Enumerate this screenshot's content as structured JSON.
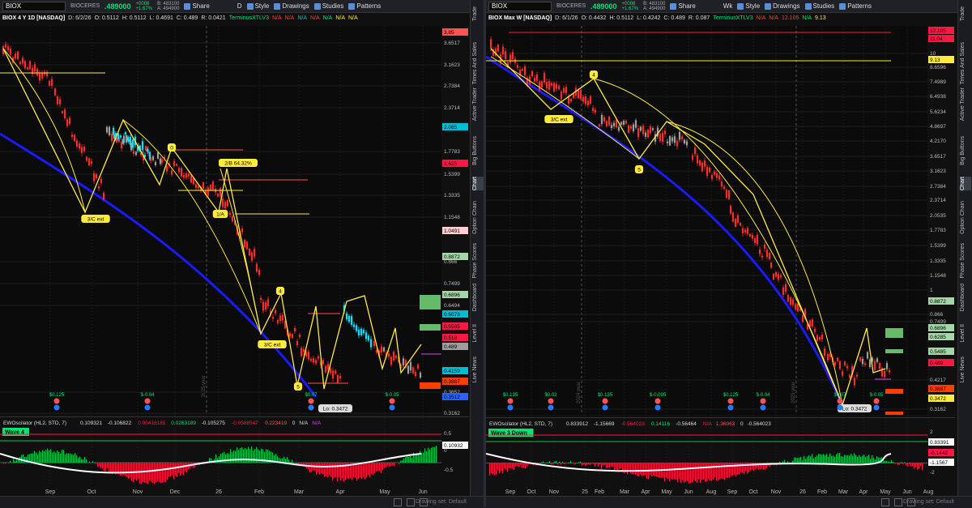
{
  "left": {
    "symbol": "BIOX",
    "company": "BIOCERES CR...",
    "price": ".489000",
    "change_line1": "+0008",
    "change_line2": "+1.67%",
    "bid": "B: 483100",
    "ask": "A: 494900",
    "timeframe_btn": "D",
    "toolbar": {
      "share": "Share",
      "style": "Style",
      "drawings": "Drawings",
      "studies": "Studies",
      "patterns": "Patterns"
    },
    "info": {
      "title": "BIOX 4 Y 1D [NASDAQ]",
      "date": "D: 6/2/26",
      "open": "O: 0.5112",
      "high": "H: 0.5112",
      "low": "L: 0.4691",
      "close": "C: 0.489",
      "range": "R: 0.0421",
      "study": "TerminusXTLV3",
      "na": "N/A"
    },
    "price_labels": [
      "3.85",
      "3.6517",
      "3.1623",
      "2.7384",
      "2.3714",
      "2.085",
      "1.7783",
      "1.625",
      "1.5399",
      "1.3335",
      "1.1548",
      "1.0491",
      "0.8872",
      "0.866",
      "0.7499",
      "0.6896",
      "0.6494",
      "0.6073",
      "0.5565",
      "0.518",
      "0.489",
      "0.4159",
      "0.3887",
      "0.3652",
      "0.3512",
      "0.3162"
    ],
    "months": [
      "Sep",
      "Oct",
      "Nov",
      "Dec",
      "26",
      "Feb",
      "Mar",
      "Apr",
      "May",
      "Jun"
    ],
    "year_label": "2025 year",
    "wave_labels": [
      "3/C ext",
      "0",
      "2/B 64.32%",
      "1/A",
      "4",
      "3/C ext",
      "5"
    ],
    "lo_label": "Lo: 0.3472",
    "earnings": [
      "$0.125",
      "$-0.04",
      "$0.07",
      "$-0.05"
    ],
    "osc_info": {
      "name": "EWOscilator (HL2, STD, 7)",
      "v1": "0.109321",
      "v2": "-0.106822",
      "v3": "0.00418181",
      "v4": "0.0263189",
      "v5": "-0.105275",
      "v6": "-0.0588547",
      "v7": "0.223419",
      "v8": "0",
      "v9": "N/A",
      "v10": "N/A"
    },
    "wave_badge": "Wave 4",
    "osc_scale": [
      "0.5",
      "0.10932",
      "0",
      "-0.5"
    ],
    "footer": "Drawing set: Default"
  },
  "right": {
    "symbol": "BIOX",
    "company": "BIOCERES CR...",
    "price": ".489000",
    "change_line1": "+0008",
    "change_line2": "+1.67%",
    "bid": "B: 483100",
    "ask": "A: 494900",
    "timeframe_btn": "Wk",
    "toolbar": {
      "share": "Share",
      "style": "Style",
      "drawings": "Drawings",
      "studies": "Studies",
      "patterns": "Patterns"
    },
    "info": {
      "title": "BIOX Max W [NASDAQ]",
      "date": "D: 6/1/26",
      "open": "O: 0.4432",
      "high": "H: 0.5112",
      "low": "L: 0.4242",
      "close": "C: 0.489",
      "range": "R: 0.087",
      "study": "TerminusXTLV3",
      "na": "N/A",
      "v1": "12.105",
      "v2": "9.13"
    },
    "price_labels": [
      "12.105",
      "11.04",
      "10",
      "9.13",
      "8.6596",
      "7.4989",
      "6.4938",
      "5.6234",
      "4.8697",
      "4.2170",
      "3.6517",
      "3.1623",
      "2.7384",
      "2.3714",
      "2.0535",
      "1.7783",
      "1.5399",
      "1.3335",
      "1.1548",
      "1",
      "0.8872",
      "0.866",
      "0.7499",
      "0.6896",
      "0.6285",
      "0.5485",
      "0.489",
      "0.4217",
      "0.3887",
      "0.3472",
      "0.3162"
    ],
    "months": [
      "Sep",
      "Oct",
      "Nov",
      "25",
      "Feb",
      "Mar",
      "Apr",
      "May",
      "Jun",
      "Aug",
      "Sep",
      "Oct",
      "Nov",
      "26",
      "Feb",
      "Mar",
      "Apr",
      "May",
      "Jun",
      "Aug"
    ],
    "year_labels": [
      "2024 year",
      "2025 year"
    ],
    "wave_labels": [
      "4",
      "3/C ext",
      "5"
    ],
    "lo_label": "Lo: 0.3472",
    "earnings": [
      "$0.135",
      "$0.02",
      "$0.135",
      "$-0.095",
      "$0.125",
      "$-0.04",
      "$0.07",
      "$-0.05"
    ],
    "osc_info": {
      "name": "EWOscilator (HL2, STD, 7)",
      "v1": "0.833912",
      "v2": "-1.15669",
      "v3": "-0.564023",
      "v4": "0.14116",
      "v5": "-0.56464",
      "v6": "N/A",
      "v7": "1.36063",
      "v8": "0",
      "v9": "-0.564023"
    },
    "wave_badge": "Wave 3 Down",
    "osc_scale": [
      "2",
      "0.83391",
      "-0.1442",
      "-1.1567",
      "-2"
    ],
    "footer": "Drawing set: Default"
  },
  "sidebar_tabs": [
    "Trade",
    "Times And Sales",
    "Active Trader",
    "Big Buttons",
    "Chart",
    "Option Chain",
    "Phase Scores",
    "Dashboard",
    "Level II",
    "Live News"
  ],
  "colors": {
    "up": "#00e5ff",
    "down": "#ff2a2a",
    "neutral": "#9e9e9e",
    "fib": "#ffeb3b",
    "curve": "#1a1aff",
    "osc_pos": "#00c853",
    "osc_neg": "#ff1744"
  }
}
